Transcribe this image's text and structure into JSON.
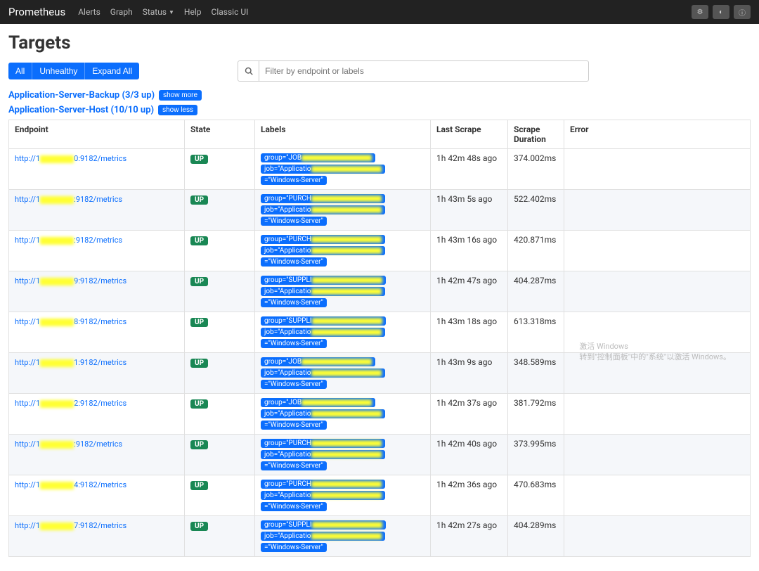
{
  "nav": {
    "brand": "Prometheus",
    "links": [
      "Alerts",
      "Graph",
      "Status",
      "Help",
      "Classic UI"
    ]
  },
  "page_title": "Targets",
  "filter": {
    "all": "All",
    "unhealthy": "Unhealthy",
    "expand": "Expand All"
  },
  "search": {
    "placeholder": "Filter by endpoint or labels"
  },
  "groups": [
    {
      "name": "Application-Server-Backup (3/3 up)",
      "button": "show more"
    },
    {
      "name": "Application-Server-Host (10/10 up)",
      "button": "show less"
    }
  ],
  "columns": {
    "endpoint": "Endpoint",
    "state": "State",
    "labels": "Labels",
    "last": "Last Scrape",
    "duration": "Scrape Duration",
    "error": "Error"
  },
  "state_label": "UP",
  "rows": [
    {
      "port": "0:9182",
      "chip1": "group=\"JOB",
      "last": "1h 42m 48s ago",
      "dur": "374.002ms"
    },
    {
      "port": ":9182",
      "chip1": "group=\"PURCH",
      "last": "1h 43m 5s ago",
      "dur": "522.402ms"
    },
    {
      "port": ":9182",
      "chip1": "group=\"PURCH",
      "last": "1h 43m 16s ago",
      "dur": "420.871ms"
    },
    {
      "port": "9:9182",
      "chip1": "group=\"SUPPLI",
      "last": "1h 42m 47s ago",
      "dur": "404.287ms"
    },
    {
      "port": "8:9182",
      "chip1": "group=\"SUPPLI",
      "last": "1h 43m 18s ago",
      "dur": "613.318ms"
    },
    {
      "port": "1:9182",
      "chip1": "group=\"JOB",
      "last": "1h 43m 9s ago",
      "dur": "348.589ms"
    },
    {
      "port": "2:9182",
      "chip1": "group=\"JOB",
      "last": "1h 42m 37s ago",
      "dur": "381.792ms"
    },
    {
      "port": ":9182",
      "chip1": "group=\"PURCH",
      "last": "1h 42m 40s ago",
      "dur": "373.995ms"
    },
    {
      "port": "4:9182",
      "chip1": "group=\"PURCH",
      "last": "1h 42m 36s ago",
      "dur": "470.683ms"
    },
    {
      "port": "7:9182",
      "chip1": "group=\"SUPPLI",
      "last": "1h 42m 27s ago",
      "dur": "404.289ms"
    }
  ],
  "endpoint_prefix": "http://1",
  "endpoint_suffix": "/metrics",
  "chip2_prefix": "job=\"Applicatio",
  "chip3_text": "=\"Windows-Server\"",
  "watermark": {
    "line1": "激活 Windows",
    "line2": "转到\"控制面板\"中的\"系统\"以激活 Windows。"
  }
}
